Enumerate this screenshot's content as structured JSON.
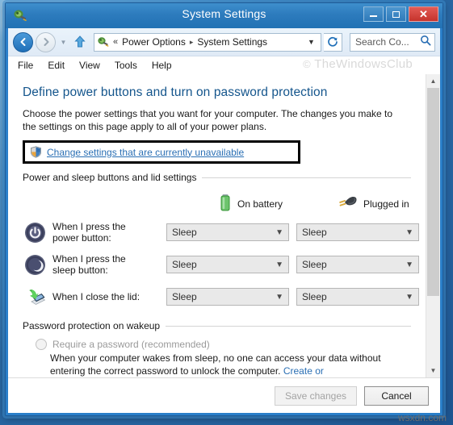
{
  "window": {
    "title": "System Settings",
    "icon": "power-options-icon",
    "controls": {
      "minimize": "minimize-button",
      "maximize": "maximize-button",
      "close": "close-button"
    }
  },
  "nav": {
    "back": "back-button",
    "forward": "forward-button",
    "history": "history-dropdown",
    "up": "up-button",
    "refresh": "refresh-button",
    "breadcrumb": {
      "double_chevron": "«",
      "items": [
        "Power Options",
        "System Settings"
      ],
      "separator": "▸"
    },
    "search": {
      "placeholder": "Search Co...",
      "value": ""
    }
  },
  "menubar": {
    "items": [
      "File",
      "Edit",
      "View",
      "Tools",
      "Help"
    ]
  },
  "watermark": {
    "top": "TheWindowsClub",
    "copyright": "©",
    "bottom": "wsxdn.com"
  },
  "page": {
    "heading": "Define power buttons and turn on password protection",
    "intro": "Choose the power settings that you want for your computer. The changes you make to the settings on this page apply to all of your power plans.",
    "uac_link": "Change settings that are currently unavailable"
  },
  "power_section": {
    "title": "Power and sleep buttons and lid settings",
    "columns": [
      {
        "label": "On battery",
        "icon": "battery-icon"
      },
      {
        "label": "Plugged in",
        "icon": "power-plug-icon"
      }
    ],
    "rows": [
      {
        "icon": "power-button-icon",
        "label": "When I press the power button:",
        "on_battery": "Sleep",
        "plugged_in": "Sleep"
      },
      {
        "icon": "sleep-moon-icon",
        "label": "When I press the sleep button:",
        "on_battery": "Sleep",
        "plugged_in": "Sleep"
      },
      {
        "icon": "laptop-lid-icon",
        "label": "When I close the lid:",
        "on_battery": "Sleep",
        "plugged_in": "Sleep"
      }
    ]
  },
  "password_section": {
    "title": "Password protection on wakeup",
    "radio_label": "Require a password (recommended)",
    "radio_selected": false,
    "description_line1": "When your computer wakes from sleep, no one can access your data without",
    "description_line2": "entering the correct password to unlock the computer.",
    "description_link": "Create or"
  },
  "footer": {
    "save_label": "Save changes",
    "save_enabled": false,
    "cancel_label": "Cancel"
  },
  "colors": {
    "window_frame": "#2a7fc9",
    "heading": "#14558c",
    "link": "#2a6fb4",
    "close_button": "#c5332c",
    "battery_green": "#5cb85c"
  }
}
